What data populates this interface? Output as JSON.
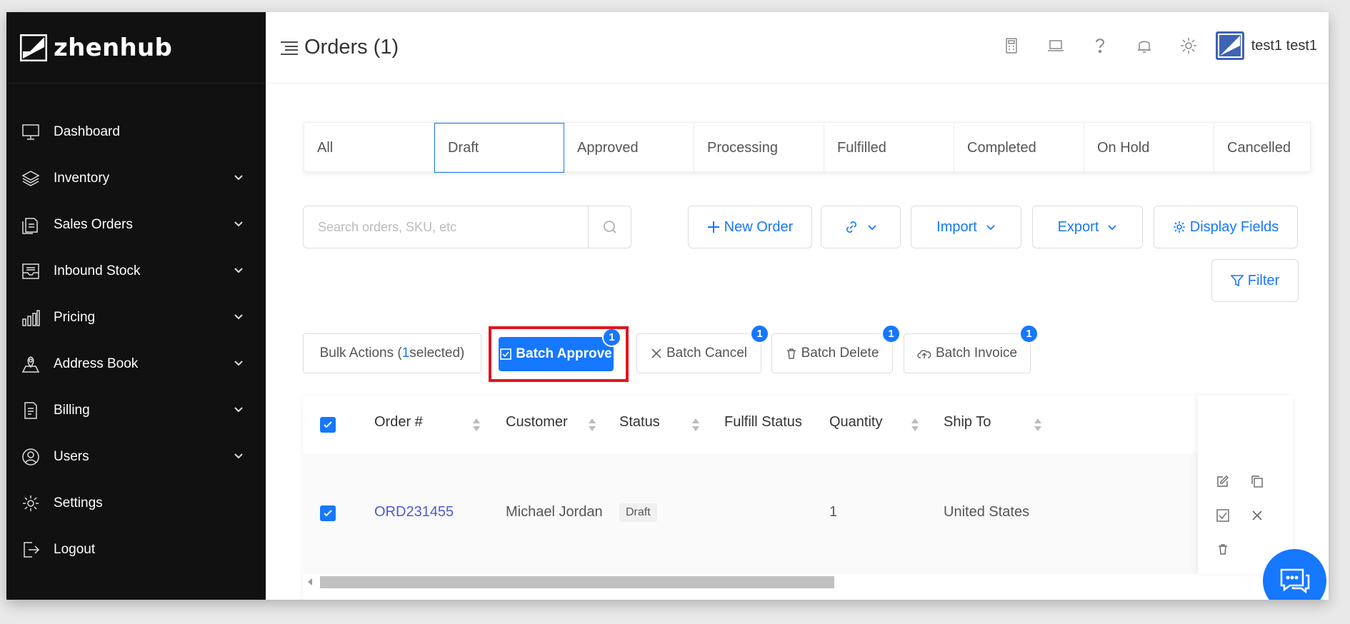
{
  "app": {
    "brand": "zhenhub"
  },
  "sidebar": {
    "items": [
      {
        "label": "Dashboard",
        "icon": "monitor-icon",
        "has_children": false
      },
      {
        "label": "Inventory",
        "icon": "layers-icon",
        "has_children": true
      },
      {
        "label": "Sales Orders",
        "icon": "documents-icon",
        "has_children": true
      },
      {
        "label": "Inbound Stock",
        "icon": "inbox-tray-icon",
        "has_children": true
      },
      {
        "label": "Pricing",
        "icon": "bar-chart-icon",
        "has_children": true
      },
      {
        "label": "Address Book",
        "icon": "map-pin-icon",
        "has_children": true
      },
      {
        "label": "Billing",
        "icon": "invoice-icon",
        "has_children": true
      },
      {
        "label": "Users",
        "icon": "users-icon",
        "has_children": true
      },
      {
        "label": "Settings",
        "icon": "gear-icon",
        "has_children": false
      },
      {
        "label": "Logout",
        "icon": "logout-icon",
        "has_children": false
      }
    ]
  },
  "header": {
    "title": "Orders (1)",
    "username": "test1 test1",
    "icons": [
      "calculator-icon",
      "laptop-icon",
      "help-icon",
      "bell-icon",
      "gear-icon"
    ]
  },
  "tabs": [
    "All",
    "Draft",
    "Approved",
    "Processing",
    "Fulfilled",
    "Completed",
    "On Hold",
    "Cancelled"
  ],
  "active_tab": "Draft",
  "search": {
    "placeholder": "Search orders, SKU, etc"
  },
  "toolbar": {
    "new_order": "New Order",
    "import": "Import",
    "export": "Export",
    "display_fields": "Display Fields",
    "filter": "Filter"
  },
  "bulk": {
    "label_prefix": "Bulk Actions (",
    "selected_count": "1",
    "label_suffix": " selected)",
    "approve": "Batch Approve",
    "cancel": "Batch Cancel",
    "delete": "Batch Delete",
    "invoice": "Batch Invoice",
    "badge": "1"
  },
  "table": {
    "columns": [
      "Order #",
      "Customer",
      "Status",
      "Fulfill Status",
      "Quantity",
      "Ship To"
    ],
    "rows": [
      {
        "order": "ORD231455",
        "customer": "Michael Jordan",
        "status": "Draft",
        "fulfill_status": "",
        "quantity": "1",
        "ship_to": "United States"
      }
    ]
  },
  "colors": {
    "accent": "#1677ff",
    "sidebar_bg": "#111111",
    "highlight": "#e0161e"
  }
}
